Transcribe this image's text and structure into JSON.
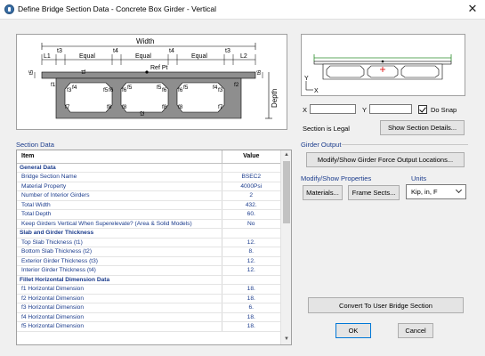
{
  "window": {
    "title": "Define Bridge Section Data - Concrete Box Girder - Vertical",
    "close_glyph": "✕"
  },
  "sketch": {
    "labels": {
      "width": "Width",
      "l1": "L1",
      "l2": "L2",
      "t3_left": "t3",
      "t3_right": "t3",
      "t4_left": "t4",
      "t4_right": "t4",
      "equal": "Equal",
      "t5": "t5",
      "t6": "t6",
      "t1": "t1",
      "t2": "t2",
      "ref_pt": "Ref Pt",
      "depth": "Depth",
      "f1": "f1",
      "f2": "f2",
      "f3": "f3",
      "f4": "f4",
      "f5": "f5",
      "f6": "f6",
      "f7": "f7",
      "f8": "f8"
    }
  },
  "preview": {
    "axis_y": "Y",
    "axis_x": "X",
    "x_label": "X",
    "y_label": "Y",
    "x_value": "",
    "y_value": "",
    "do_snap_label": "Do Snap",
    "do_snap_checked": true,
    "status": "Section is Legal",
    "show_details_button": "Show Section Details..."
  },
  "section_data": {
    "group_label": "Section Data",
    "col_item": "Item",
    "col_value": "Value",
    "rows": [
      {
        "type": "header",
        "item": "General Data",
        "value": ""
      },
      {
        "type": "row",
        "item": "Bridge Section Name",
        "value": "BSEC2"
      },
      {
        "type": "row",
        "item": "Material Property",
        "value": "4000Psi"
      },
      {
        "type": "row",
        "item": "Number of Interior Girders",
        "value": "2"
      },
      {
        "type": "row",
        "item": "Total Width",
        "value": "432."
      },
      {
        "type": "row",
        "item": "Total Depth",
        "value": "60."
      },
      {
        "type": "row",
        "item": "Keep Girders Vertical When Superelevate?  (Area & Solid Models)",
        "value": "No"
      },
      {
        "type": "header",
        "item": "Slab and Girder Thickness",
        "value": ""
      },
      {
        "type": "row",
        "item": "Top Slab Thickness (t1)",
        "value": "12."
      },
      {
        "type": "row",
        "item": "Bottom Slab Thickness (t2)",
        "value": "8."
      },
      {
        "type": "row",
        "item": "Exterior Girder Thickness (t3)",
        "value": "12."
      },
      {
        "type": "row",
        "item": "Interior Girder Thickness (t4)",
        "value": "12."
      },
      {
        "type": "header",
        "item": "Fillet Horizontal Dimension Data",
        "value": ""
      },
      {
        "type": "row",
        "item": "f1 Horizontal Dimension",
        "value": "18."
      },
      {
        "type": "row",
        "item": "f2 Horizontal Dimension",
        "value": "18."
      },
      {
        "type": "row",
        "item": "f3 Horizontal Dimension",
        "value": "6."
      },
      {
        "type": "row",
        "item": "f4 Horizontal Dimension",
        "value": "18."
      },
      {
        "type": "row",
        "item": "f5 Horizontal Dimension",
        "value": "18."
      }
    ]
  },
  "girder_output": {
    "group_label": "Girder Output",
    "button": "Modify/Show Girder Force Output Locations..."
  },
  "modify_show": {
    "group_label": "Modify/Show Properties",
    "materials_button": "Materials...",
    "frame_sects_button": "Frame Sects..."
  },
  "units": {
    "group_label": "Units",
    "selected": "Kip, in, F"
  },
  "footer": {
    "convert_button": "Convert To User Bridge Section",
    "ok_button": "OK",
    "cancel_button": "Cancel"
  }
}
